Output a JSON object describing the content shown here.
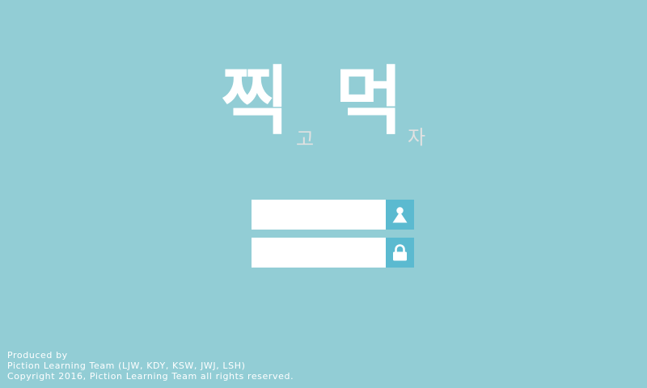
{
  "logo": {
    "char_1": "찍",
    "char_2": "고",
    "char_3": "먹",
    "char_4": "자"
  },
  "login": {
    "username_value": "",
    "password_value": "",
    "username_icon": "user-icon",
    "password_icon": "lock-icon"
  },
  "footer": {
    "line_1": "Produced by",
    "line_2": "Piction Learning Team (LJW, KDY, KSW, JWJ, LSH)",
    "line_3": "Copyright 2016, Piction Learning Team all rights reserved."
  },
  "colors": {
    "background": "#92cdd5",
    "icon_button": "#5bbad0",
    "field": "#ffffff",
    "logo_main": "#ffffff",
    "logo_sub": "#e1e1e1"
  }
}
